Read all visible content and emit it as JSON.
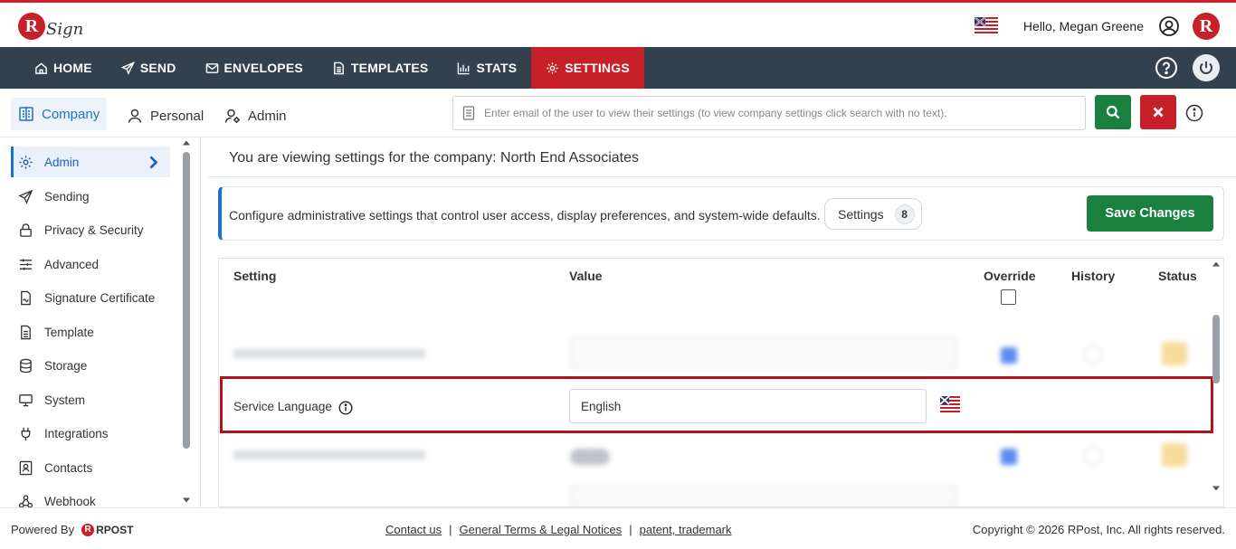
{
  "app": {
    "logo_text": "RSign"
  },
  "header": {
    "greeting": "Hello, Megan Greene",
    "brand_letter": "R"
  },
  "nav": {
    "items": [
      {
        "label": "HOME",
        "icon": "home-icon"
      },
      {
        "label": "SEND",
        "icon": "send-icon"
      },
      {
        "label": "ENVELOPES",
        "icon": "envelope-icon"
      },
      {
        "label": "TEMPLATES",
        "icon": "document-icon"
      },
      {
        "label": "STATS",
        "icon": "chart-icon"
      },
      {
        "label": "SETTINGS",
        "icon": "gear-icon",
        "active": true
      }
    ]
  },
  "subtabs": [
    {
      "label": "Company",
      "active": true
    },
    {
      "label": "Personal"
    },
    {
      "label": "Admin"
    }
  ],
  "search": {
    "placeholder": "Enter email of the user to view their settings (to view company settings click search with no text)."
  },
  "sidebar": {
    "items": [
      {
        "label": "Admin",
        "active": true
      },
      {
        "label": "Sending"
      },
      {
        "label": "Privacy & Security"
      },
      {
        "label": "Advanced"
      },
      {
        "label": "Signature Certificate"
      },
      {
        "label": "Template"
      },
      {
        "label": "Storage"
      },
      {
        "label": "System"
      },
      {
        "label": "Integrations"
      },
      {
        "label": "Contacts"
      },
      {
        "label": "Webhook"
      }
    ]
  },
  "main": {
    "title": "You are viewing settings for the company: North End Associates",
    "description": "Configure administrative settings that control user access, display preferences, and system-wide defaults.",
    "settings_label": "Settings",
    "settings_count": "8",
    "save_label": "Save Changes"
  },
  "table": {
    "headers": {
      "setting": "Setting",
      "value": "Value",
      "override": "Override",
      "history": "History",
      "status": "Status"
    },
    "highlighted_row": {
      "label": "Service Language",
      "value": "English"
    }
  },
  "footer": {
    "powered_by": "Powered By",
    "rpost": "RPOST",
    "links": [
      "Contact us",
      "General Terms & Legal Notices",
      "patent, trademark"
    ],
    "separator": "|",
    "copyright": "Copyright © 2026 RPost, Inc. All rights reserved."
  },
  "colors": {
    "brand_red": "#c8202a",
    "nav_bg": "#33414f",
    "primary_green": "#198040",
    "accent_blue": "#1a6fd6"
  }
}
